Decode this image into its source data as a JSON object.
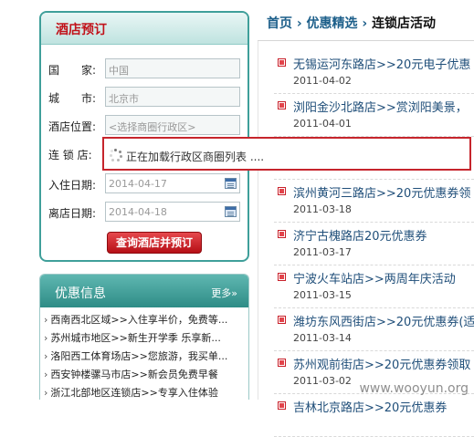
{
  "booking": {
    "title": "酒店预订",
    "fields": [
      {
        "label": "国　　家:",
        "value": "中国"
      },
      {
        "label": "城　　市:",
        "value": "北京市"
      },
      {
        "label": "酒店位置:",
        "value": "<选择商圈行政区>"
      },
      {
        "label": "连 锁 店:",
        "value": ""
      },
      {
        "label": "入住日期:",
        "value": "2014-04-17"
      },
      {
        "label": "离店日期:",
        "value": "2014-04-18"
      }
    ],
    "search_label": "查询酒店并预订"
  },
  "promo": {
    "title": "优惠信息",
    "more": "更多»",
    "items": [
      "西南西北区域>>入住享半价，免费等...",
      "苏州城市地区>>新生开学季 乐享新...",
      "洛阳西工体育场店>>您旅游，我买单...",
      "西安钟楼骡马市店>>新会员免费早餐",
      "浙江北部地区连锁店>>专享入住体验"
    ]
  },
  "breadcrumb": {
    "home": "首页",
    "sep1": " › ",
    "section": "优惠精选",
    "sep2": " › ",
    "current": "连锁店活动"
  },
  "articles": [
    {
      "title": "无锡运河东路店>>20元电子优惠",
      "date": "2011-04-02"
    },
    {
      "title": "浏阳金沙北路店>>赏浏阳美景，",
      "date": "2011-04-01"
    },
    {
      "title": "",
      "date": ""
    },
    {
      "title": "滨州黄河三路店>>20元优惠券领",
      "date": "2011-03-18"
    },
    {
      "title": "济宁古槐路店20元优惠券",
      "date": "2011-03-17"
    },
    {
      "title": "宁波火车站店>>两周年庆活动",
      "date": "2011-03-15"
    },
    {
      "title": "潍坊东风西街店>>20元优惠券(适",
      "date": "2011-03-14"
    },
    {
      "title": "苏州观前街店>>20元优惠券领取",
      "date": "2011-03-02"
    },
    {
      "title": "吉林北京路店>>20元优惠券",
      "date": ""
    }
  ],
  "loading": {
    "text": "正在加载行政区商圈列表 ...."
  },
  "watermark": "www.wooyun.org",
  "colors": {
    "accent": "#3f9f9a",
    "brand_red": "#c1121a",
    "link": "#1f4e79"
  }
}
